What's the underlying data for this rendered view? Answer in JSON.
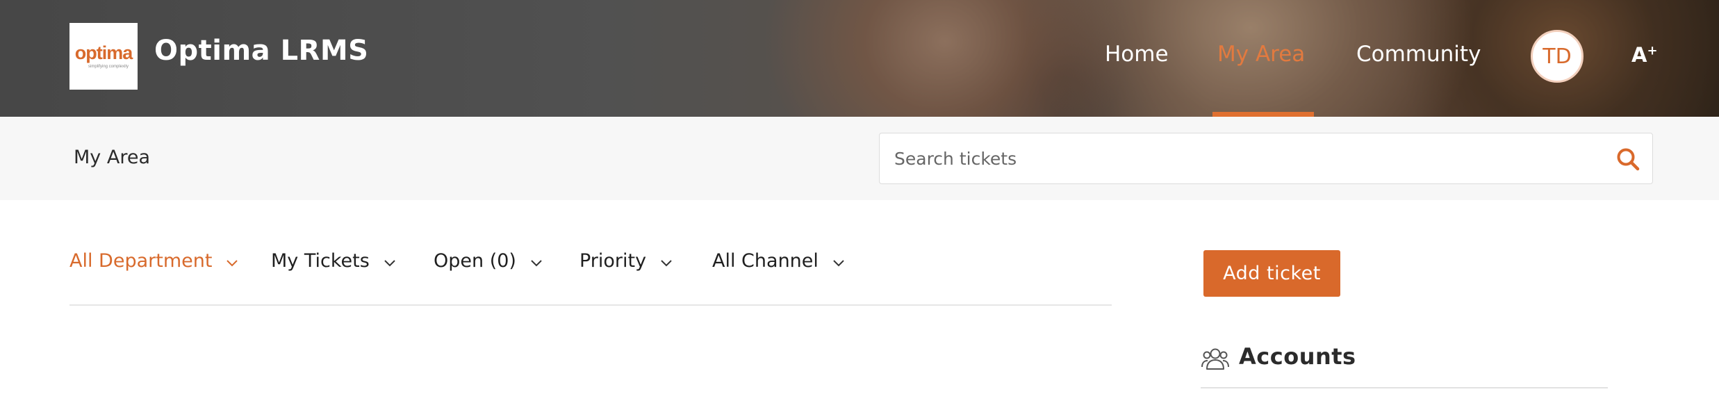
{
  "header": {
    "logo": {
      "word": "optima",
      "tagline": "simplifying complexity"
    },
    "app_title": "Optima LRMS",
    "nav": [
      {
        "label": "Home",
        "active": false
      },
      {
        "label": "My Area",
        "active": true
      },
      {
        "label": "Community",
        "active": false
      }
    ],
    "avatar_initials": "TD",
    "font_size_toggle": "A",
    "font_size_toggle_sup": "+",
    "icon": "font-size-increase-icon"
  },
  "subbar": {
    "breadcrumb": "My Area",
    "search": {
      "placeholder": "Search tickets",
      "value": "",
      "icon": "search-icon"
    }
  },
  "filters": [
    {
      "label": "All Department",
      "active": true
    },
    {
      "label": "My Tickets",
      "active": false
    },
    {
      "label": "Open (0)",
      "active": false
    },
    {
      "label": "Priority",
      "active": false
    },
    {
      "label": "All Channel",
      "active": false
    }
  ],
  "sidebar": {
    "add_ticket_label": "Add ticket",
    "accounts_title": "Accounts",
    "accounts_icon": "users-icon"
  },
  "colors": {
    "accent": "#d9692b",
    "nav_active": "#e27a3f",
    "subbar_bg": "#f7f7f7",
    "text": "#1f1f1f"
  }
}
